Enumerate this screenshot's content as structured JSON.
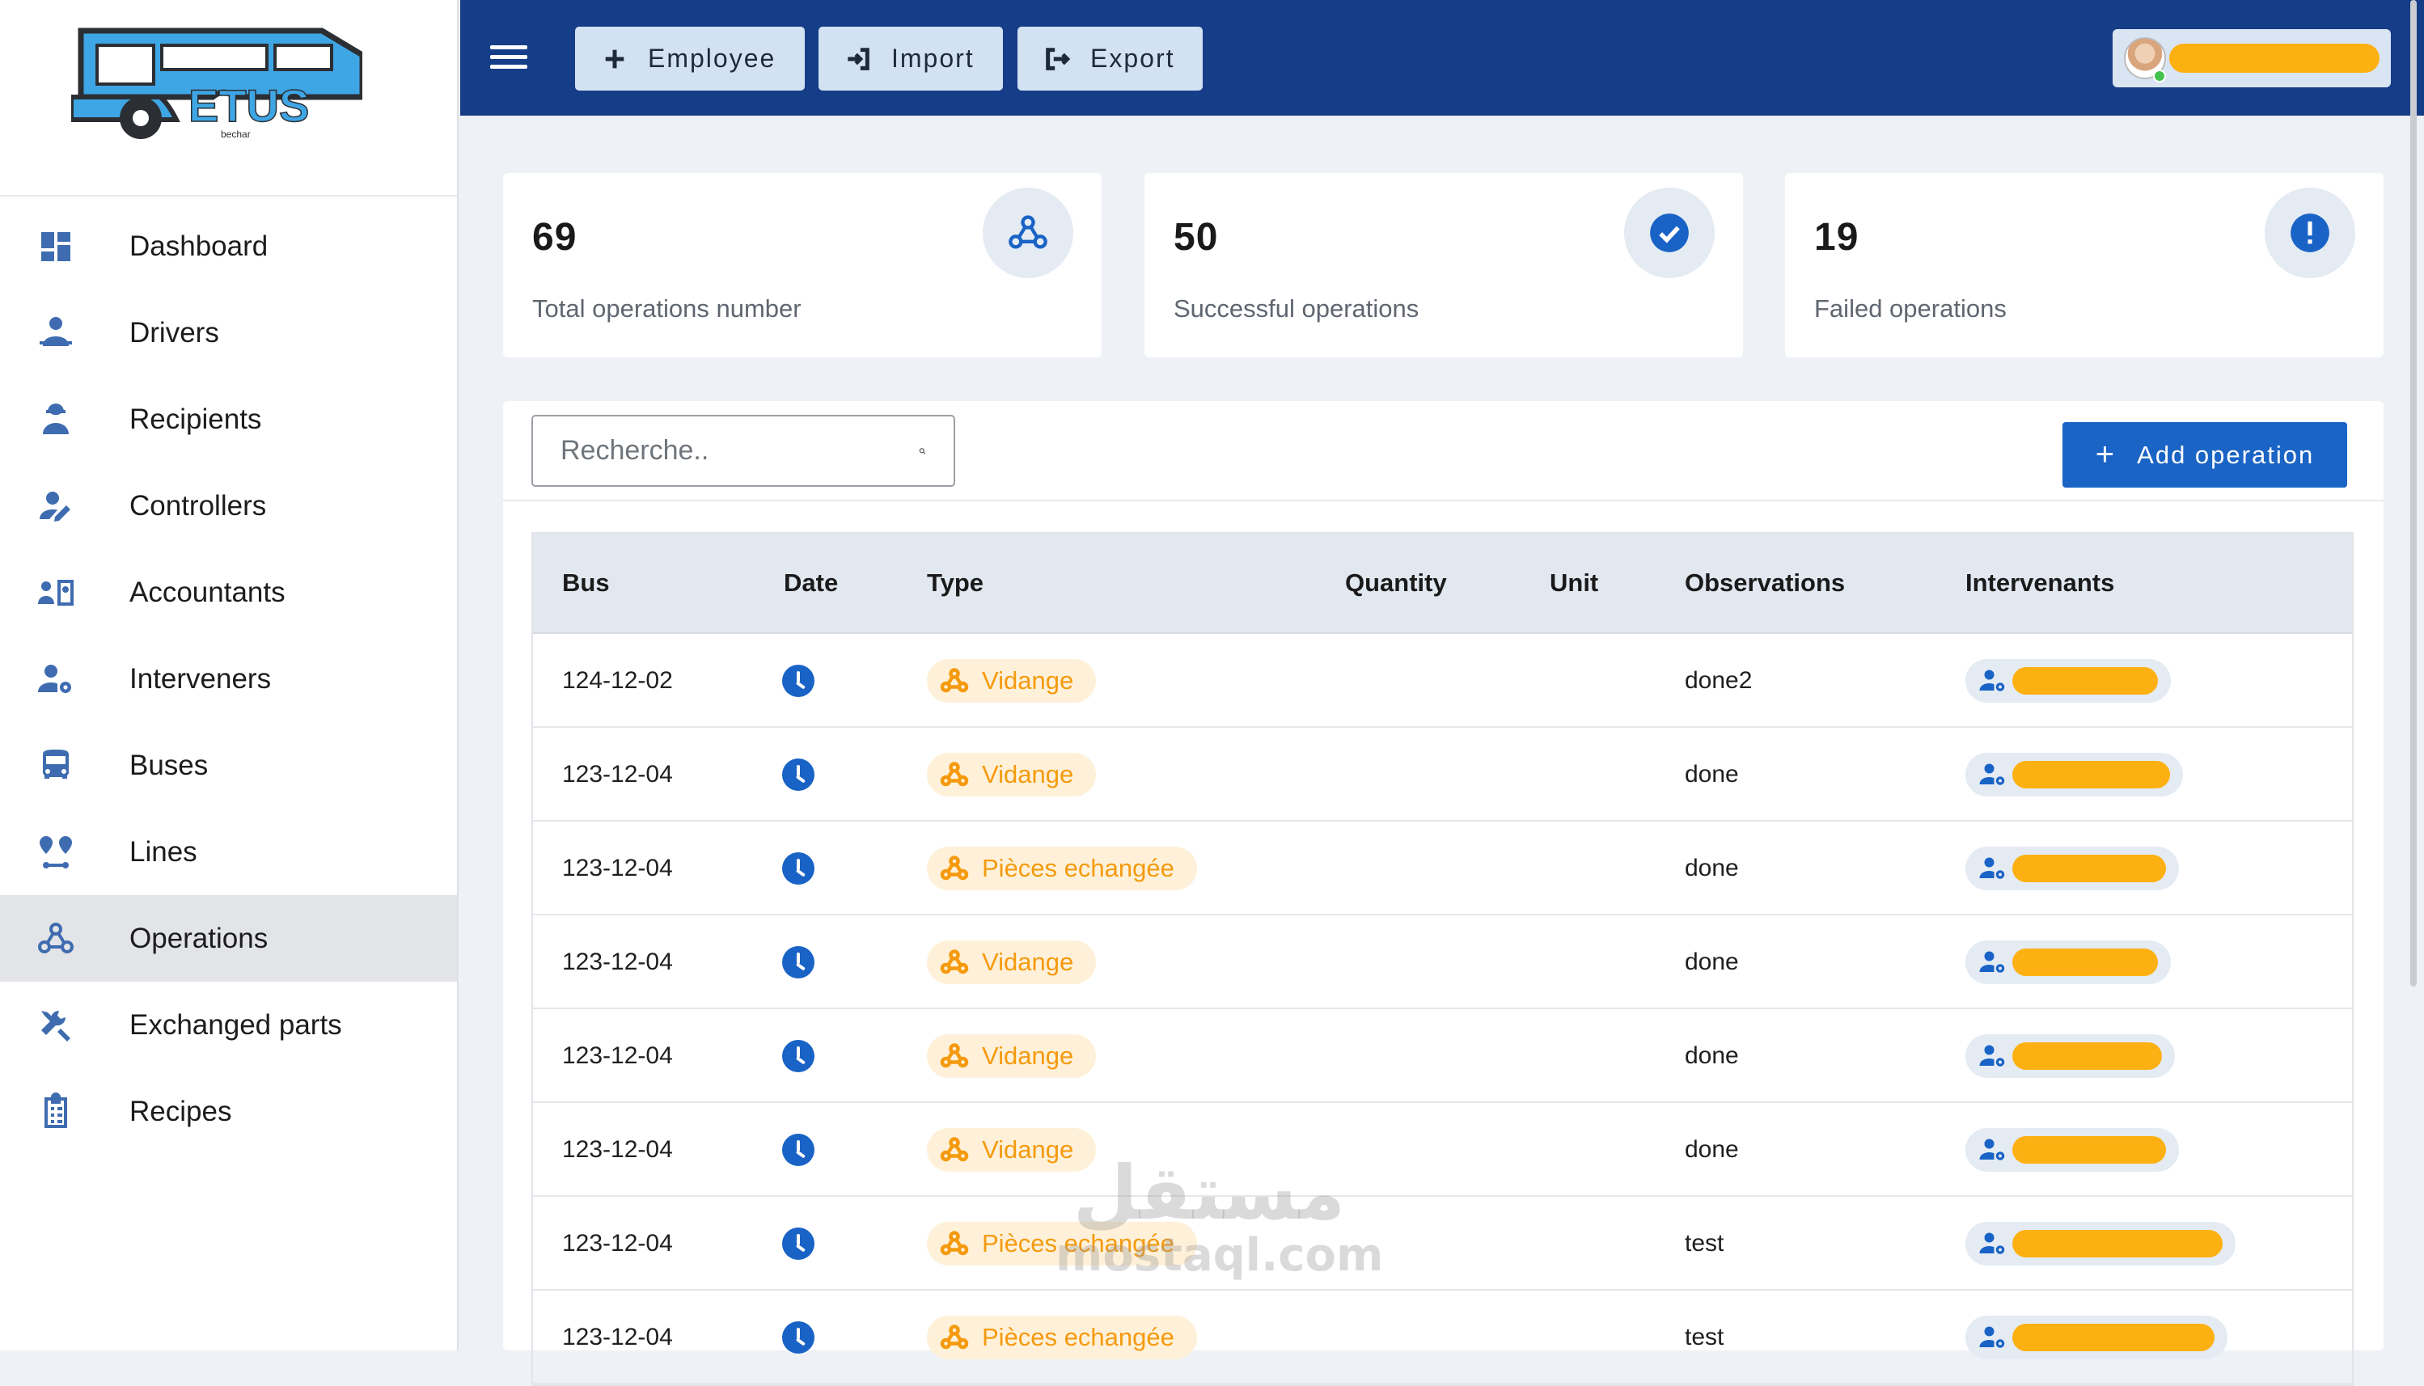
{
  "logo": {
    "text": "ETUS",
    "subtext": "bechar"
  },
  "sidebar": {
    "items": [
      {
        "label": "Dashboard",
        "icon": "dashboard-icon"
      },
      {
        "label": "Drivers",
        "icon": "driver-icon"
      },
      {
        "label": "Recipients",
        "icon": "worker-icon"
      },
      {
        "label": "Controllers",
        "icon": "user-edit-icon"
      },
      {
        "label": "Accountants",
        "icon": "id-card-icon"
      },
      {
        "label": "Interveners",
        "icon": "user-gear-icon"
      },
      {
        "label": "Buses",
        "icon": "bus-icon"
      },
      {
        "label": "Lines",
        "icon": "route-icon"
      },
      {
        "label": "Operations",
        "icon": "webhook-icon",
        "active": true
      },
      {
        "label": "Exchanged parts",
        "icon": "tools-icon"
      },
      {
        "label": "Recipes",
        "icon": "clipboard-icon"
      }
    ]
  },
  "toolbar": {
    "employee_label": "Employee",
    "import_label": "Import",
    "export_label": "Export"
  },
  "stats": {
    "total": {
      "value": "69",
      "label": "Total operations number"
    },
    "success": {
      "value": "50",
      "label": "Successful operations"
    },
    "failed": {
      "value": "19",
      "label": "Failed operations"
    }
  },
  "search": {
    "placeholder": "Recherche.."
  },
  "add_operation_label": "Add operation",
  "table": {
    "headers": [
      "Bus",
      "Date",
      "Type",
      "Quantity",
      "Unit",
      "Observations",
      "Intervenants"
    ],
    "rows": [
      {
        "bus": "124-12-02",
        "type": "Vidange",
        "quantity": "",
        "unit": "",
        "observations": "done2"
      },
      {
        "bus": "123-12-04",
        "type": "Vidange",
        "quantity": "",
        "unit": "",
        "observations": "done"
      },
      {
        "bus": "123-12-04",
        "type": "Pièces echangée",
        "quantity": "",
        "unit": "",
        "observations": "done"
      },
      {
        "bus": "123-12-04",
        "type": "Vidange",
        "quantity": "",
        "unit": "",
        "observations": "done"
      },
      {
        "bus": "123-12-04",
        "type": "Vidange",
        "quantity": "",
        "unit": "",
        "observations": "done"
      },
      {
        "bus": "123-12-04",
        "type": "Vidange",
        "quantity": "",
        "unit": "",
        "observations": "done"
      },
      {
        "bus": "123-12-04",
        "type": "Pièces echangée",
        "quantity": "",
        "unit": "",
        "observations": "test"
      },
      {
        "bus": "123-12-04",
        "type": "Pièces echangée",
        "quantity": "",
        "unit": "",
        "observations": "test"
      }
    ]
  },
  "watermark": {
    "arabic": "مستقل",
    "latin": "mostaql.com"
  },
  "colors": {
    "topbar": "#163d87",
    "accent": "#1a64c6",
    "type_chip_text": "#f59a0e",
    "type_chip_bg": "#fff1d9",
    "redaction": "#fdb011",
    "success": "#1963c6"
  }
}
